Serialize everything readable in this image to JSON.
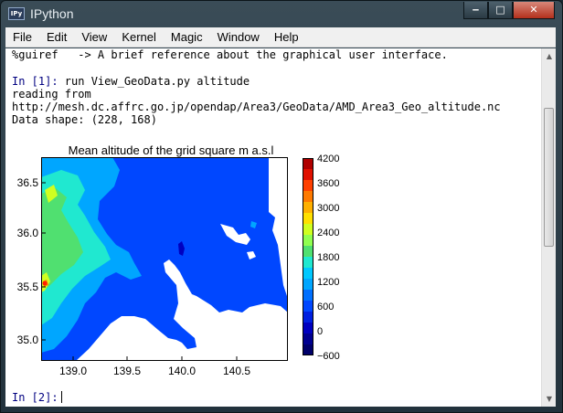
{
  "window": {
    "title": "IPython",
    "icon_label": "IPy",
    "buttons": {
      "minimize": "‒",
      "maximize": "□",
      "close": "✕"
    }
  },
  "menu": [
    "File",
    "Edit",
    "View",
    "Kernel",
    "Magic",
    "Window",
    "Help"
  ],
  "console": {
    "line1": "%guiref   -> A brief reference about the graphical user interface.",
    "prompt1": "In [1]:",
    "cmd1": " run View_GeoData.py altitude",
    "line3": "reading from",
    "line4": "http://mesh.dc.affrc.go.jp/opendap/Area3/GeoData/AMD_Area3_Geo_altitude.nc",
    "line5": "Data shape: (228, 168)",
    "prompt2": "In [2]:"
  },
  "chart_data": {
    "type": "heatmap",
    "title": "Mean altitude of the grid square m a.s.l",
    "xlim": [
      138.73,
      140.83
    ],
    "ylim": [
      34.85,
      36.73
    ],
    "x_ticks": [
      "139.0",
      "139.5",
      "140.0",
      "140.5"
    ],
    "y_ticks": [
      "36.5",
      "36.0",
      "35.5",
      "35.0"
    ],
    "colorbar": {
      "range": [
        -600,
        4200
      ],
      "ticks": [
        "4200",
        "3600",
        "3000",
        "2400",
        "1800",
        "1200",
        "600",
        "0",
        "−600"
      ]
    },
    "grid_shape": [
      228,
      168
    ],
    "ocean_color": "#ffffff",
    "colors": {
      "low": "#0000c0",
      "land": "#0047ff",
      "mid": "#00a6ff",
      "mid2": "#20e8d0",
      "green": "#50e070",
      "high": "#d0ff20",
      "peak": "#ff2000"
    }
  }
}
